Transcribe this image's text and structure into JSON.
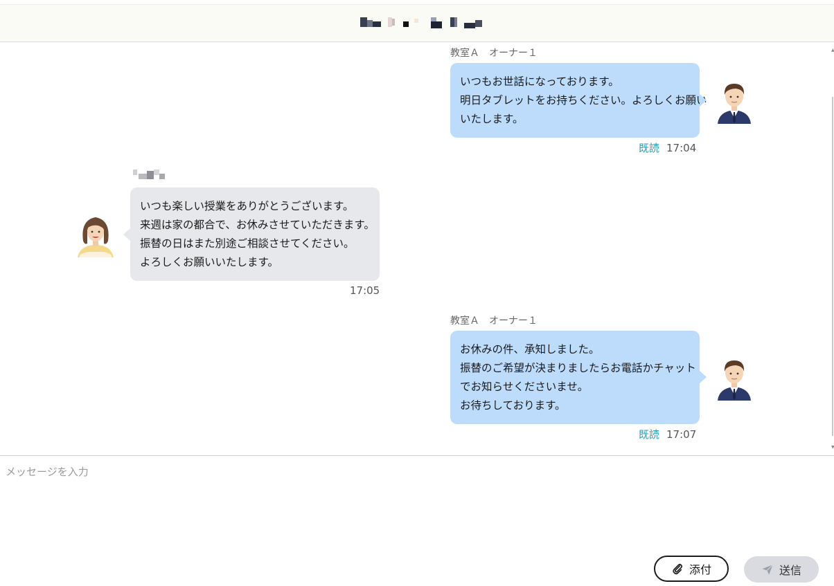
{
  "header": {
    "title_redacted": true
  },
  "messages": [
    {
      "side": "mine",
      "sender": "教室Ａ　オーナー１",
      "lines": [
        "いつもお世話になっております。",
        "明日タブレットをお持ちください。よろしくお願い",
        "いたします。"
      ],
      "read_label": "既読",
      "time": "17:04",
      "avatar": "male-staff-avatar"
    },
    {
      "side": "theirs",
      "sender_redacted": true,
      "lines": [
        "いつも楽しい授業をありがとうございます。",
        "来週は家の都合で、お休みさせていただきます。",
        "振替の日はまた別途ご相談させてください。",
        "よろしくお願いいたします。"
      ],
      "time": "17:05",
      "avatar": "female-parent-avatar"
    },
    {
      "side": "mine",
      "sender": "教室Ａ　オーナー１",
      "lines": [
        "お休みの件、承知しました。",
        "振替のご希望が決まりましたらお電話かチャット",
        "でお知らせくださいませ。",
        "お待ちしております。"
      ],
      "read_label": "既読",
      "time": "17:07",
      "avatar": "male-staff-avatar"
    }
  ],
  "composer": {
    "placeholder": "メッセージを入力",
    "value": "",
    "attach_label": "添付",
    "send_label": "送信"
  },
  "colors": {
    "my_bubble": "#bddcfb",
    "their_bubble": "#e7e8ec",
    "read_text": "#2a9bb7",
    "header_bg": "#fbfbf6"
  }
}
